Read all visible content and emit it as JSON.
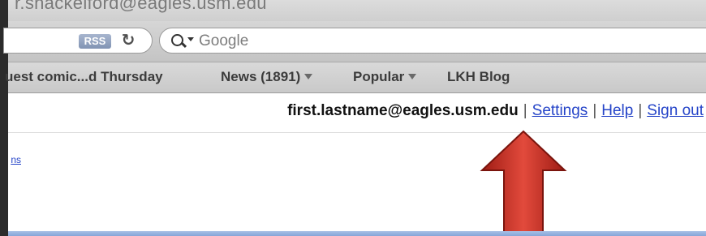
{
  "window": {
    "title_partial": "r.shackelford@eagles.usm.edu"
  },
  "toolbar": {
    "rss_label": "RSS",
    "reload_glyph": "↻",
    "search_placeholder": "Google"
  },
  "bookmarks": {
    "items": [
      {
        "label": "uest comic...d Thursday",
        "has_dropdown": false
      },
      {
        "label": "News (1891)",
        "has_dropdown": true
      },
      {
        "label": "Popular",
        "has_dropdown": true
      },
      {
        "label": "LKH Blog",
        "has_dropdown": false
      }
    ]
  },
  "account": {
    "email": "first.lastname@eagles.usm.edu",
    "separator": "|",
    "settings": "Settings",
    "help": "Help",
    "sign_out": "Sign out"
  },
  "content": {
    "partial_link": "ns"
  },
  "colors": {
    "link": "#2544c8",
    "arrow": "#c0271d",
    "accent_strip": "#86a6d8"
  }
}
